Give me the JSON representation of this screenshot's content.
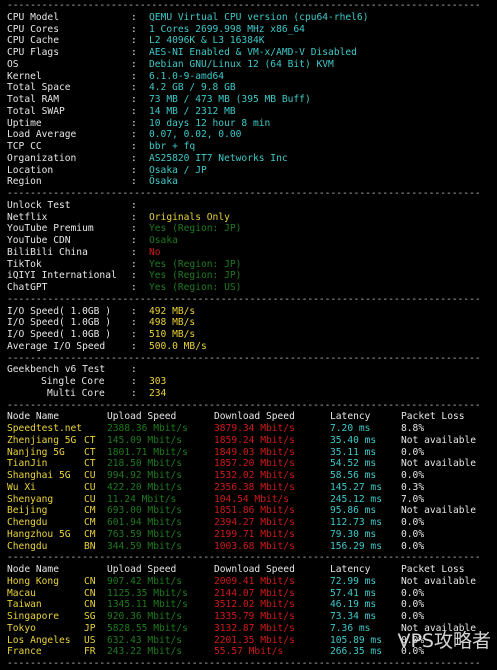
{
  "system": [
    {
      "key": "CPU Model",
      "value": "QEMU Virtual CPU version (cpu64-rhel6)"
    },
    {
      "key": "CPU Cores",
      "value": "1 Cores 2699.998 MHz x86_64"
    },
    {
      "key": "CPU Cache",
      "value": "L2 4096K & L3 16384K"
    },
    {
      "key": "CPU Flags",
      "value": "AES-NI Enabled & VM-x/AMD-V Disabled"
    },
    {
      "key": "OS",
      "value": "Debian GNU/Linux 12 (64 Bit) KVM"
    },
    {
      "key": "Kernel",
      "value": "6.1.0-9-amd64"
    },
    {
      "key": "Total Space",
      "value": "4.2 GB / 9.8 GB"
    },
    {
      "key": "Total RAM",
      "value": "73 MB / 473 MB (395 MB Buff)"
    },
    {
      "key": "Total SWAP",
      "value": "14 MB / 2312 MB"
    },
    {
      "key": "Uptime",
      "value": "10 days 12 hour 8 min"
    },
    {
      "key": "Load Average",
      "value": "0.07, 0.02, 0.00"
    },
    {
      "key": "TCP CC",
      "value": "bbr + fq"
    },
    {
      "key": "Organization",
      "value": "AS25820 IT7 Networks Inc"
    },
    {
      "key": "Location",
      "value": "Osaka / JP"
    },
    {
      "key": "Region",
      "value": "Ōsaka"
    }
  ],
  "unlock": [
    {
      "key": "Unlock Test",
      "value": "",
      "color": "dim"
    },
    {
      "key": "Netflix",
      "value": "Originals Only",
      "color": "yel"
    },
    {
      "key": "YouTube Premium",
      "value": "Yes (Region: JP)",
      "color": "dgrn"
    },
    {
      "key": "YouTube CDN",
      "value": "Osaka",
      "color": "dgrn"
    },
    {
      "key": "BiliBili China",
      "value": "No",
      "color": "red"
    },
    {
      "key": "TikTok",
      "value": "Yes (Region: JP)",
      "color": "dgrn"
    },
    {
      "key": "iQIYI International",
      "value": "Yes (Region: JP)",
      "color": "dgrn"
    },
    {
      "key": "ChatGPT",
      "value": "Yes (Region: US)",
      "color": "dgrn"
    }
  ],
  "io": [
    {
      "key": "I/O Speed( 1.0GB )",
      "value": "492 MB/s"
    },
    {
      "key": "I/O Speed( 1.0GB )",
      "value": "498 MB/s"
    },
    {
      "key": "I/O Speed( 1.0GB )",
      "value": "510 MB/s"
    },
    {
      "key": "Average I/O Speed",
      "value": "500.0 MB/s"
    }
  ],
  "geekbench": {
    "title": "Geekbench v6 Test",
    "single_label": "Single Core",
    "single": "303",
    "multi_label": "Multi Core",
    "multi": "234"
  },
  "speed_headers": [
    "Node Name",
    "Upload Speed",
    "Download Speed",
    "Latency",
    "Packet Loss"
  ],
  "speed_table_1": [
    [
      "Speedtest.net",
      "",
      "2388.36 Mbit/s",
      "3879.34 Mbit/s",
      "7.20 ms",
      "8.8%"
    ],
    [
      "Zhenjiang 5G",
      "CT",
      "145.09 Mbit/s",
      "1859.24 Mbit/s",
      "35.40 ms",
      "Not available"
    ],
    [
      "Nanjing 5G",
      "CT",
      "1801.71 Mbit/s",
      "1849.03 Mbit/s",
      "35.11 ms",
      "0.0%"
    ],
    [
      "TianJin",
      "CT",
      "218.50 Mbit/s",
      "1857.20 Mbit/s",
      "54.52 ms",
      "Not available"
    ],
    [
      "Shanghai 5G",
      "CU",
      "994.92 Mbit/s",
      "1532.02 Mbit/s",
      "58.56 ms",
      "0.0%"
    ],
    [
      "Wu Xi",
      "CU",
      "422.20 Mbit/s",
      "2356.38 Mbit/s",
      "145.27 ms",
      "0.3%"
    ],
    [
      "Shenyang",
      "CU",
      "11.24 Mbit/s",
      "104.54 Mbit/s",
      "245.12 ms",
      "7.0%"
    ],
    [
      "Beijing",
      "CM",
      "693.00 Mbit/s",
      "1851.86 Mbit/s",
      "95.86 ms",
      "Not available"
    ],
    [
      "Chengdu",
      "CM",
      "601.94 Mbit/s",
      "2394.27 Mbit/s",
      "112.73 ms",
      "0.0%"
    ],
    [
      "Hangzhou 5G",
      "CM",
      "763.59 Mbit/s",
      "2199.71 Mbit/s",
      "79.30 ms",
      "0.0%"
    ],
    [
      "Chengdu",
      "BN",
      "344.59 Mbit/s",
      "1003.68 Mbit/s",
      "156.29 ms",
      "0.0%"
    ]
  ],
  "speed_table_2": [
    [
      "Hong Kong",
      "CN",
      "907.42 Mbit/s",
      "2009.41 Mbit/s",
      "72.99 ms",
      "Not available"
    ],
    [
      "Macau",
      "CN",
      "1125.35 Mbit/s",
      "2144.07 Mbit/s",
      "57.41 ms",
      "0.0%"
    ],
    [
      "Taiwan",
      "CN",
      "1345.11 Mbit/s",
      "3512.02 Mbit/s",
      "46.19 ms",
      "0.0%"
    ],
    [
      "Singapore",
      "SG",
      "920.36 Mbit/s",
      "1335.79 Mbit/s",
      "73.34 ms",
      "0.0%"
    ],
    [
      "Tokyo",
      "JP",
      "5828.55 Mbit/s",
      "3132.87 Mbit/s",
      "7.36 ms",
      "Not available"
    ],
    [
      "Los Angeles",
      "US",
      "632.43 Mbit/s",
      "2201.35 Mbit/s",
      "105.89 ms",
      "0.0%"
    ],
    [
      "France",
      "FR",
      "243.22 Mbit/s",
      "55.57 Mbit/s",
      "266.35 ms",
      "0.0%"
    ]
  ],
  "watermark": "VPS攻略者",
  "colors": {
    "background": "#000000",
    "label": "#e6e6e6",
    "system_value": "#3fc9c9",
    "io_value": "#e9d23a",
    "node": "#e9d23a",
    "upload": "#1f7a1f",
    "download": "#d11a1a",
    "latency": "#3fc9c9",
    "separator": "#bdbdbd"
  }
}
